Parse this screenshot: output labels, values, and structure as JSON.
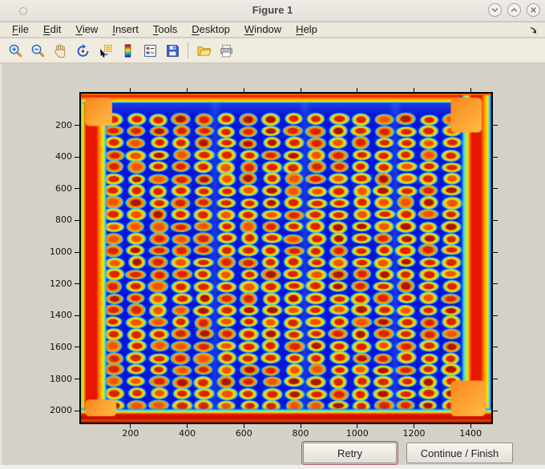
{
  "window": {
    "title": "Figure 1",
    "controls": [
      {
        "name": "minimize",
        "glyph": "chevron-down"
      },
      {
        "name": "maximize",
        "glyph": "chevron-up"
      },
      {
        "name": "close",
        "glyph": "x"
      }
    ]
  },
  "menubar": {
    "items": [
      {
        "label": "File",
        "underline": 0
      },
      {
        "label": "Edit",
        "underline": 0
      },
      {
        "label": "View",
        "underline": 0
      },
      {
        "label": "Insert",
        "underline": 0
      },
      {
        "label": "Tools",
        "underline": 0
      },
      {
        "label": "Desktop",
        "underline": 0
      },
      {
        "label": "Window",
        "underline": 0
      },
      {
        "label": "Help",
        "underline": 0
      }
    ]
  },
  "toolbar": {
    "buttons": [
      "zoom-in",
      "zoom-out",
      "pan",
      "rotate-3d",
      "data-cursor",
      "colorbar",
      "legend",
      "save",
      "separator",
      "open-folder",
      "print"
    ]
  },
  "buttons": {
    "retry": "Retry",
    "continue": "Continue / Finish"
  },
  "colors": {
    "background_blue": "#0a14d8",
    "spot_core": "#d62500",
    "spot_core_dark": "#aa1700",
    "spot_core_bright": "#ee5500",
    "spot_ring_yellow": "#ffd200",
    "spot_ring_orange": "#ff9100",
    "spot_halo_cyan": "#2fd8ef",
    "band_red": "#e81500",
    "band_yellow": "#ffe600",
    "band_cyan": "#22dcff",
    "blob_orange": "#f9881c",
    "figure_bg": "#d4d1c9",
    "focus_ring": "#b0566e"
  },
  "chart_data": {
    "type": "heatmap",
    "title": "",
    "xlabel": "",
    "ylabel": "",
    "colormap": "jet",
    "x_ticks": [
      200,
      400,
      600,
      800,
      1000,
      1200,
      1400
    ],
    "y_ticks": [
      200,
      400,
      600,
      800,
      1000,
      1200,
      1400,
      1600,
      1800,
      2000
    ],
    "x_range": [
      25,
      1473
    ],
    "y_range": [
      0,
      2075
    ],
    "grid_on": false,
    "description": "Microarray plate scan: deep-blue field, 16 x 25 grid of spots (red-orange cores, yellow rings, cyan halos), saturated red border bands along all four plate edges with orange corner blobs",
    "grid": {
      "columns": 16,
      "rows": 25,
      "first_col_x": 141,
      "col_spacing": 79.4,
      "first_row_y": 162,
      "row_spacing": 75.3,
      "spot_rx_units": 26,
      "spot_ry_units": 29
    },
    "seams_x": [
      498,
      816,
      1134
    ],
    "border_bands": {
      "left_extent_x": 118,
      "top_extent_y": 62,
      "right_start_x": 1362,
      "bottom_start_y": 1980
    },
    "corner_blobs": [
      {
        "x0": 40,
        "y0": 25,
        "x1": 135,
        "y1": 205
      },
      {
        "x0": 1330,
        "y0": 25,
        "x1": 1440,
        "y1": 245
      },
      {
        "x0": 1330,
        "y0": 1810,
        "x1": 1452,
        "y1": 2035
      },
      {
        "x0": 40,
        "y0": 1930,
        "x1": 150,
        "y1": 2035
      }
    ]
  }
}
